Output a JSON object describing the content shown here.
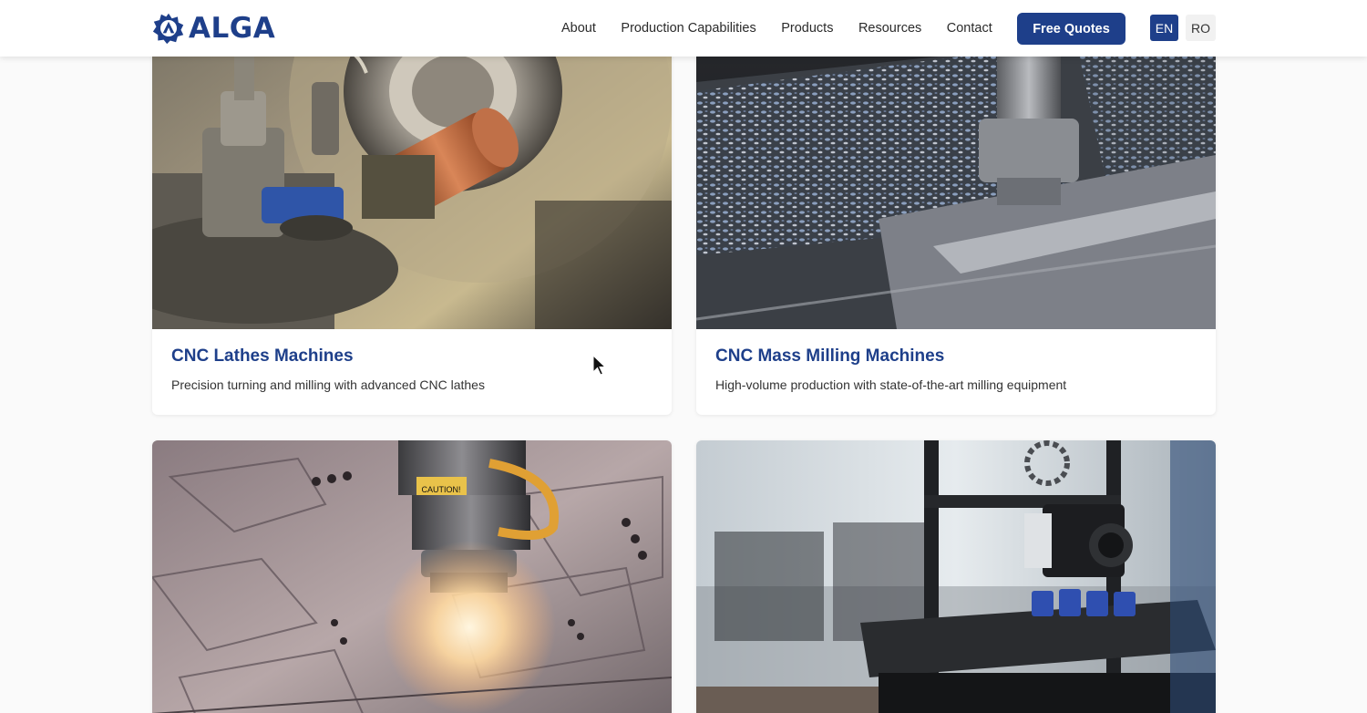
{
  "header": {
    "logo_text": "ALGA",
    "nav": [
      "About",
      "Production Capabilities",
      "Products",
      "Resources",
      "Contact"
    ],
    "cta_label": "Free Quotes",
    "languages": [
      {
        "code": "EN",
        "active": true
      },
      {
        "code": "RO",
        "active": false
      }
    ]
  },
  "cards": [
    {
      "title": "CNC Lathes Machines",
      "description": "Precision turning and milling with advanced CNC lathes",
      "image": "cnc-lathe-photo"
    },
    {
      "title": "CNC Mass Milling Machines",
      "description": "High-volume production with state-of-the-art milling equipment",
      "image": "cnc-milling-photo"
    },
    {
      "title": "",
      "description": "",
      "image": "laser-cutting-photo",
      "image_text": "CAUTION!"
    },
    {
      "title": "",
      "description": "",
      "image": "3d-printer-photo"
    }
  ],
  "colors": {
    "brand": "#1e3f8a",
    "background": "#fafafa",
    "card": "#ffffff"
  }
}
